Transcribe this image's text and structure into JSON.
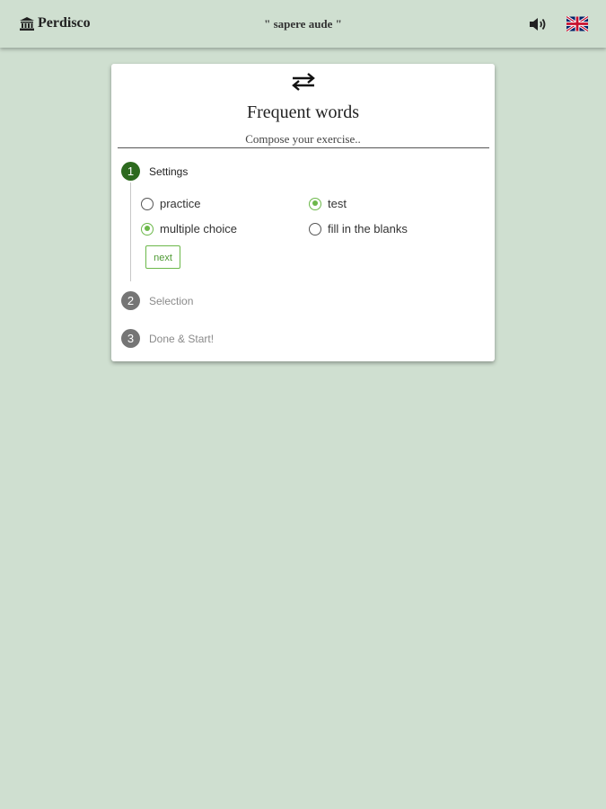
{
  "header": {
    "brand": "Perdisco",
    "motto": "\" sapere aude \"",
    "icons": [
      "museum-icon",
      "speaker-icon",
      "uk-flag-icon"
    ]
  },
  "card": {
    "icon": "swap-arrows-icon",
    "title": "Frequent words",
    "subtitle": "Compose your exercise..",
    "steps": [
      {
        "number": "1",
        "label": "Settings",
        "active": true
      },
      {
        "number": "2",
        "label": "Selection",
        "active": false
      },
      {
        "number": "3",
        "label": "Done & Start!",
        "active": false
      }
    ],
    "settings": {
      "mode_options": [
        {
          "label": "practice",
          "checked": false
        },
        {
          "label": "test",
          "checked": true
        }
      ],
      "type_options": [
        {
          "label": "multiple choice",
          "checked": true
        },
        {
          "label": "fill in the blanks",
          "checked": false
        }
      ],
      "next_label": "next"
    }
  },
  "colors": {
    "background": "#cfdfd0",
    "accent_green": "#6cb84a",
    "step_active": "#2d6a1f",
    "step_inactive": "#757575"
  }
}
